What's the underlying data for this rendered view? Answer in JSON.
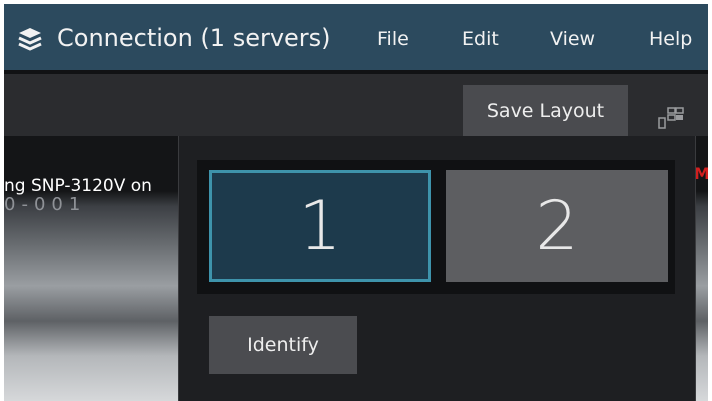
{
  "window": {
    "title": "Connection (1 servers)",
    "icon": "stack-layers-icon"
  },
  "menu": {
    "items": [
      "File",
      "Edit",
      "View",
      "Help"
    ]
  },
  "toolbar": {
    "save_layout_label": "Save Layout",
    "layout_icon": "monitor-layout-icon"
  },
  "video": {
    "camera_label": "ng SNP-3120V on",
    "overlay_text": "0-001",
    "rec_indicator": "M"
  },
  "monitor_popup": {
    "monitors": [
      {
        "label": "1",
        "selected": true
      },
      {
        "label": "2",
        "selected": false
      }
    ],
    "identify_label": "Identify"
  },
  "colors": {
    "titlebar": "#2c4a5e",
    "accent": "#3e93ab",
    "selected_monitor": "#1d3a4c",
    "monitor": "#5d5e61",
    "button": "#4a4b4f"
  }
}
